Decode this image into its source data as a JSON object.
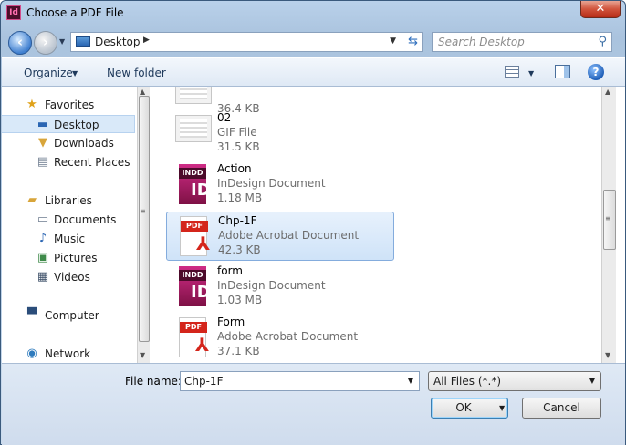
{
  "window": {
    "title": "Choose a PDF File",
    "app_icon": "Id",
    "close_glyph": "✕"
  },
  "address": {
    "location": "Desktop",
    "search_placeholder": "Search Desktop"
  },
  "toolbar": {
    "organize": "Organize",
    "new_folder": "New folder",
    "help": "?"
  },
  "nav": {
    "favorites": "Favorites",
    "desktop": "Desktop",
    "downloads": "Downloads",
    "recent": "Recent Places",
    "libraries": "Libraries",
    "documents": "Documents",
    "music": "Music",
    "pictures": "Pictures",
    "videos": "Videos",
    "computer": "Computer",
    "network": "Network"
  },
  "files": [
    {
      "name": "",
      "type": "",
      "size": "36.4 KB",
      "icon": "image-thumbnail"
    },
    {
      "name": "02",
      "type": "GIF File",
      "size": "31.5 KB",
      "icon": "image-thumbnail"
    },
    {
      "name": "Action",
      "type": "InDesign Document",
      "size": "1.18 MB",
      "icon": "indd-icon",
      "badge": "INDD",
      "mark": "ID"
    },
    {
      "name": "Chp-1F",
      "type": "Adobe Acrobat Document",
      "size": "42.3 KB",
      "icon": "pdf-icon",
      "badge": "PDF",
      "mark": "⅄",
      "selected": true
    },
    {
      "name": "form",
      "type": "InDesign Document",
      "size": "1.03 MB",
      "icon": "indd-icon",
      "badge": "INDD",
      "mark": "ID"
    },
    {
      "name": "Form",
      "type": "Adobe Acrobat Document",
      "size": "37.1 KB",
      "icon": "pdf-icon",
      "badge": "PDF",
      "mark": "⅄"
    }
  ],
  "bottom": {
    "file_name_label": "File name:",
    "file_name_value": "Chp-1F",
    "filter": "All Files (*.*)",
    "ok": "OK",
    "cancel": "Cancel"
  }
}
